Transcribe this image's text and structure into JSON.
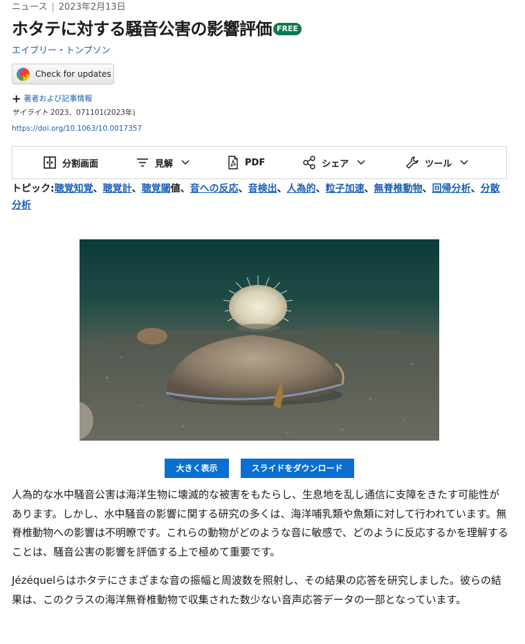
{
  "header": {
    "category": "ニュース",
    "separator": "|",
    "date": "2023年2月13日",
    "title": "ホタテに対する騒音公害の影響評価",
    "free_badge": "FREE",
    "author": "エイブリー・トンプソン"
  },
  "updates_button": {
    "label": "Check for updates"
  },
  "article_info": {
    "toggle_label": "著者および記事情報",
    "citation_journal": "サイライト",
    "citation_rest": " 2023、071101(2023年)",
    "doi": "https://doi.org/10.1063/10.0017357"
  },
  "toolbar": {
    "split_view": "分割画面",
    "views": "見解",
    "pdf": "PDF",
    "share": "シェア",
    "tools": "ツール"
  },
  "topics": {
    "lead": "トピック:",
    "items": [
      "聴覚知覚",
      "聴覚計",
      "聴覚閾",
      "値",
      "音への反応",
      "音検出",
      "人為的",
      "粒子加速",
      "無脊椎動物",
      "回帰分析",
      "分散分析"
    ],
    "sep": "、"
  },
  "figure_buttons": {
    "enlarge": "大きく表示",
    "download": "スライドをダウンロード"
  },
  "body": {
    "p1": "人為的な水中騒音公害は海洋生物に壊滅的な被害をもたらし、生息地を乱し通信に支障をきたす可能性があります。しかし、水中騒音の影響に関する研究の多くは、海洋哺乳類や魚類に対して行われています。無脊椎動物への影響は不明瞭です。これらの動物がどのような音に敏感で、どのように反応するかを理解することは、騒音公害の影響を評価する上で極めて重要です。",
    "p2": "Jézéquelらはホタテにさまざまな音の振幅と周波数を照射し、その結果の応答を研究しました。彼らの結果は、このクラスの海洋無脊椎動物で収集された数少ない音声応答データの一部となっています。"
  },
  "colors": {
    "link": "#1a5fb4",
    "free": "#0e7a4c",
    "button": "#0a6fd1"
  },
  "icons": [
    "split-screen-icon",
    "filter-lines-icon",
    "pdf-file-icon",
    "share-icon",
    "wrench-icon",
    "chevron-down-icon",
    "plus-icon",
    "crossmark-icon"
  ]
}
